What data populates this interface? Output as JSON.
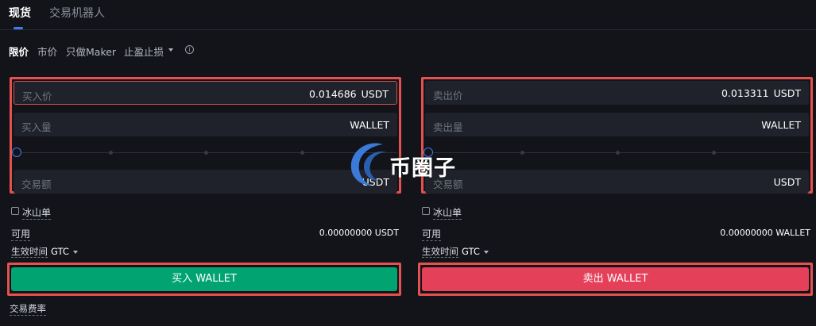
{
  "tabs": [
    {
      "label": "现货",
      "active": true
    },
    {
      "label": "交易机器人",
      "active": false
    }
  ],
  "order_types": {
    "limit": "限价",
    "market": "市价",
    "maker": "只做Maker",
    "stop": "止盈止损"
  },
  "buy": {
    "price_label": "买入价",
    "price_value": "0.014686",
    "price_unit": "USDT",
    "amount_label": "买入量",
    "amount_unit": "WALLET",
    "total_label": "交易额",
    "total_unit": "USDT",
    "iceberg_label": "冰山单",
    "available_label": "可用",
    "available_value": "0.00000000 USDT",
    "tif_label": "生效时间",
    "tif_value": "GTC",
    "button_label": "买入 WALLET",
    "fee_label": "交易费率"
  },
  "sell": {
    "price_label": "卖出价",
    "price_value": "0.013311",
    "price_unit": "USDT",
    "amount_label": "卖出量",
    "amount_unit": "WALLET",
    "total_label": "交易额",
    "total_unit": "USDT",
    "iceberg_label": "冰山单",
    "available_label": "可用",
    "available_value": "0.00000000 WALLET",
    "tif_label": "生效时间",
    "tif_value": "GTC",
    "button_label": "卖出 WALLET"
  },
  "watermark": {
    "text": "币圈子"
  },
  "colors": {
    "background": "#12141a",
    "field": "#1f222a",
    "buy": "#01a471",
    "sell": "#e4405a",
    "accent": "#3d7bf4",
    "highlight": "#e5514e"
  },
  "icons": {
    "info": "info-icon",
    "caret": "caret-down-icon"
  }
}
